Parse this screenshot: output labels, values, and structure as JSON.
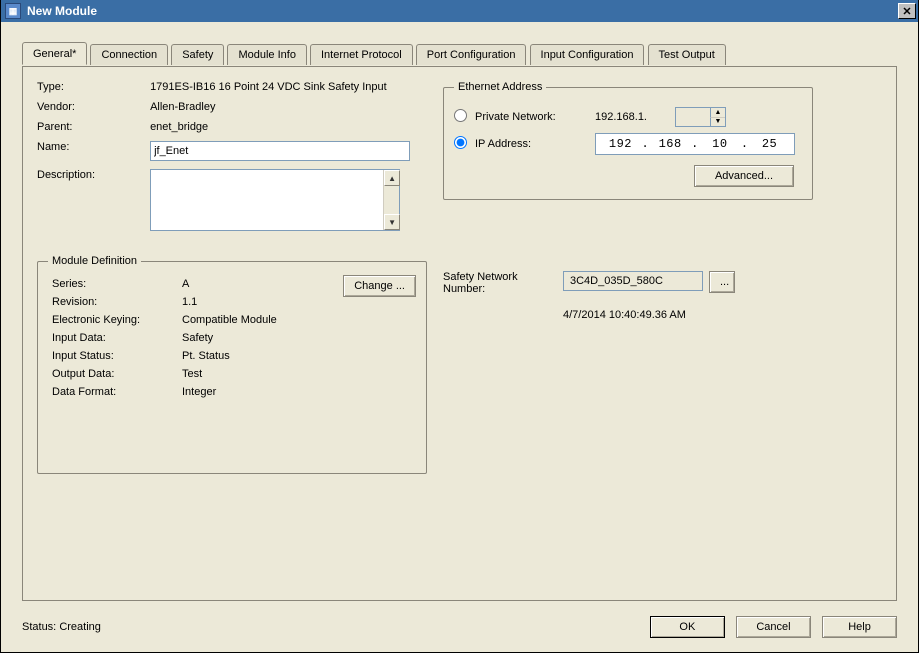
{
  "window": {
    "title": "New Module"
  },
  "tabs": [
    "General*",
    "Connection",
    "Safety",
    "Module Info",
    "Internet Protocol",
    "Port Configuration",
    "Input Configuration",
    "Test Output"
  ],
  "labels": {
    "type": "Type:",
    "vendor": "Vendor:",
    "parent": "Parent:",
    "name": "Name:",
    "description": "Description:"
  },
  "values": {
    "type": "1791ES-IB16 16 Point 24 VDC Sink Safety Input",
    "vendor": "Allen-Bradley",
    "parent": "enet_bridge",
    "name": "jf_Enet",
    "description": ""
  },
  "moddef": {
    "legend": "Module Definition",
    "change": "Change ...",
    "rows": {
      "series": {
        "k": "Series:",
        "v": "A"
      },
      "revision": {
        "k": "Revision:",
        "v": "1.1"
      },
      "ekey": {
        "k": "Electronic Keying:",
        "v": "Compatible Module"
      },
      "idata": {
        "k": "Input Data:",
        "v": "Safety"
      },
      "istat": {
        "k": "Input Status:",
        "v": "Pt. Status"
      },
      "odata": {
        "k": "Output Data:",
        "v": "Test"
      },
      "dfmt": {
        "k": "Data Format:",
        "v": "Integer"
      }
    }
  },
  "eth": {
    "legend": "Ethernet Address",
    "private_label": "Private Network:",
    "private_prefix": "192.168.1.",
    "private_octet": "",
    "ip_label": "IP Address:",
    "ip": [
      "192",
      "168",
      "10",
      "25"
    ],
    "ip_dot": ".",
    "selected": "ip",
    "advanced": "Advanced..."
  },
  "snn": {
    "label": "Safety Network\nNumber:",
    "label1": "Safety Network",
    "label2": "Number:",
    "value": "3C4D_035D_580C",
    "more": "...",
    "timestamp": "4/7/2014 10:40:49.36 AM"
  },
  "status": {
    "label": "Status:",
    "value": "Creating"
  },
  "buttons": {
    "ok": "OK",
    "cancel": "Cancel",
    "help": "Help"
  }
}
